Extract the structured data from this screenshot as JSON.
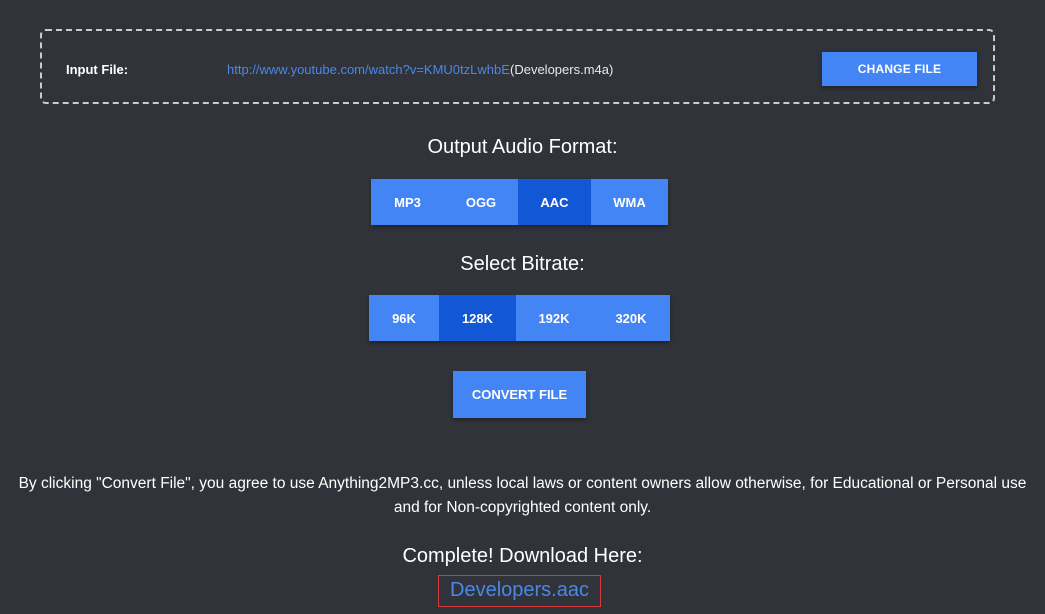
{
  "input_file": {
    "label": "Input File:",
    "url": "http://www.youtube.com/watch?v=KMU0tzLwhbE",
    "filename": "(Developers.m4a)",
    "change_button_label": "CHANGE FILE"
  },
  "output_format": {
    "title": "Output Audio Format:",
    "options": [
      "MP3",
      "OGG",
      "AAC",
      "WMA"
    ],
    "selected": "AAC"
  },
  "bitrate": {
    "title": "Select Bitrate:",
    "options": [
      "96K",
      "128K",
      "192K",
      "320K"
    ],
    "selected": "128K"
  },
  "convert_button_label": "CONVERT FILE",
  "disclaimer": {
    "line1": "By clicking \"Convert File\", you agree to use Anything2MP3.cc, unless local laws or content owners allow otherwise, for Educational or Personal use",
    "line2": "and for Non-copyrighted content only."
  },
  "download": {
    "title": "Complete! Download Here:",
    "link_text": "Developers.aac"
  },
  "colors": {
    "background": "#30333a",
    "button": "#4385f4",
    "button_active": "#1258d6",
    "link": "#4a88e8",
    "highlight_border": "#d83a3a"
  }
}
